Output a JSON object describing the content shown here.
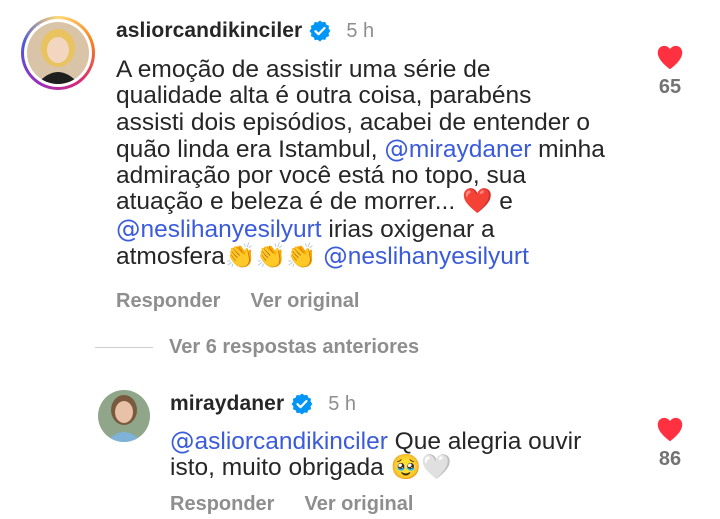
{
  "comment1": {
    "username": "asliorcandikinciler",
    "time": "5 h",
    "text_before": "A emoção de assistir uma série de",
    "line2": "qualidade alta é outra coisa, parabéns",
    "line3": "assisti dois episódios, acabei de entender o",
    "line4_prefix": "quão linda era Istambul, ",
    "mention1": "miraydaner",
    "line4_suffix": " minha",
    "line5": "admiração por você está no topo, sua",
    "line6_prefix": "atuação e beleza é de morrer... ",
    "heart_emoji": "❤️",
    "line6_suffix": " e",
    "mention2": "neslihanyesilyurt",
    "line7_suffix": " irias oxigenar a",
    "line8_prefix": "atmosfera",
    "clap_emojis": "👏👏👏",
    "mention3": "neslihanyesilyurt",
    "reply_label": "Responder",
    "view_original_label": "Ver original",
    "like_count": "65"
  },
  "replies": {
    "label": "Ver 6 respostas anteriores"
  },
  "comment2": {
    "username": "miraydaner",
    "time": "5 h",
    "mention": "asliorcandikinciler",
    "text_line1_suffix": " Que alegria ouvir",
    "text_line2": "isto, muito obrigada ",
    "emojis": "🥹🤍",
    "reply_label": "Responder",
    "view_original_label": "Ver original",
    "like_count": "86"
  },
  "colors": {
    "heart": "#ff3040",
    "verified": "#0095f6",
    "mention": "#3b5bdb",
    "muted": "#8e8e8e"
  },
  "icons": {
    "verified": "verified-badge-icon",
    "like": "heart-icon"
  }
}
